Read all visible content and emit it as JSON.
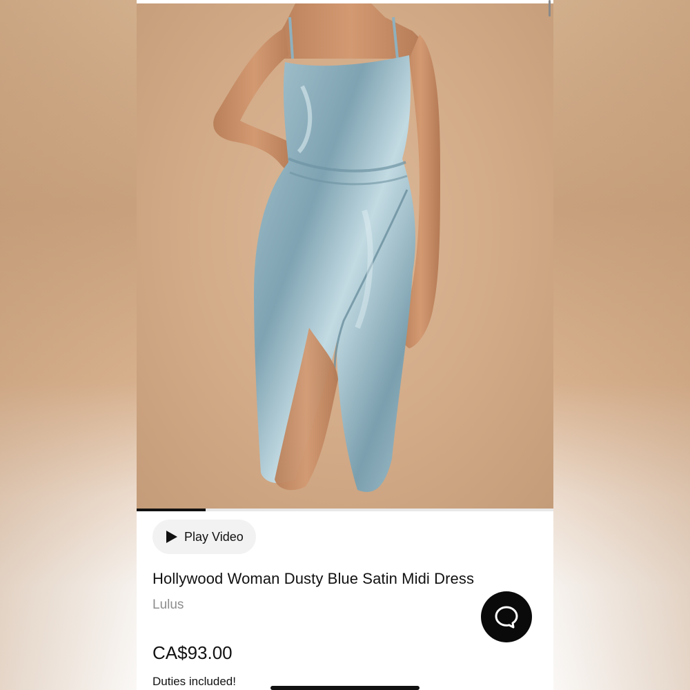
{
  "product": {
    "image_alt": "Model wearing dusty blue satin wrap midi dress",
    "gallery_progress": 0.165,
    "play_video_label": "Play Video",
    "play_icon": "play-icon",
    "title": "Hollywood Woman Dusty Blue Satin Midi Dress",
    "brand": "Lulus",
    "price": "CA$93.00",
    "duties_note": "Duties included!"
  },
  "chat": {
    "icon": "chat-bubble-icon"
  },
  "colors": {
    "dress": "#8fb0bd",
    "background": "#d2aa87",
    "text": "#111111",
    "muted": "#8c8c8c"
  }
}
